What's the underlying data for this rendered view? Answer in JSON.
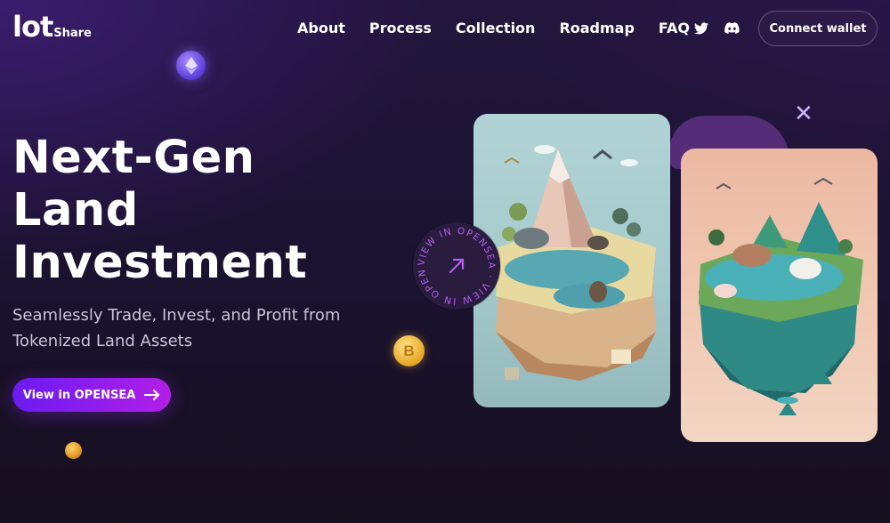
{
  "brand": {
    "name_main": "lot",
    "name_sub": "Share"
  },
  "nav": {
    "items": [
      {
        "label": "About"
      },
      {
        "label": "Process"
      },
      {
        "label": "Collection"
      },
      {
        "label": "Roadmap"
      },
      {
        "label": "FAQ"
      }
    ]
  },
  "social": {
    "icons": [
      "twitter-icon",
      "discord-icon"
    ]
  },
  "header": {
    "connect_label": "Connect wallet"
  },
  "hero": {
    "title_line1": "Next-Gen",
    "title_line2": "Land",
    "title_line3": "Investment",
    "subtitle_line1": "Seamlessly Trade, Invest, and Profit from",
    "subtitle_line2": "Tokenized Land Assets",
    "cta_label": "View in OPENSEA"
  },
  "badge": {
    "ring_text": "VIEW IN OPENSEA · VIEW IN OPENSEA · "
  },
  "coins": {
    "btc_symbol": "B"
  },
  "colors": {
    "accent_start": "#6a1cf0",
    "accent_end": "#b21ee8",
    "background": "#1b1230",
    "badge_text": "#b35cf0"
  }
}
